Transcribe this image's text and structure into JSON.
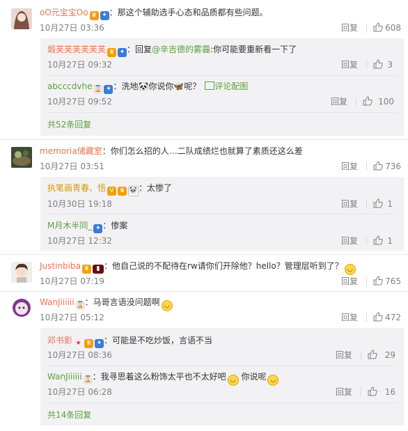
{
  "comments": [
    {
      "user": "oO元宝宝Oo",
      "text": "：那这个辅助选手心态和品质都有些问题。",
      "time": "10月27日 03:36",
      "reply": "回复",
      "likes": "608",
      "replies": [
        {
          "user": "煅芙芙芙芙芙芙",
          "mention": "@辛吉德的雾霾",
          "pre": "：回复",
          "text": ":你可能要重新看一下了",
          "time": "10月27日 09:32",
          "reply": "回复",
          "likes": "3"
        },
        {
          "user": "abcccdvhe",
          "text": "：洗地🐼你说你🦋呢？",
          "pic_link": "评论配图",
          "time": "10月27日 09:52",
          "reply": "回复",
          "likes": "100"
        }
      ],
      "more": "共52条回复"
    },
    {
      "user": "memoria储藏室",
      "text": "：你们怎么招的人…二队成绩烂也就算了素质还这么差",
      "time": "10月27日 03:51",
      "reply": "回复",
      "likes": "736",
      "replies": [
        {
          "user": "执笔画青春、悟",
          "text": "：太惨了",
          "time": "10月30日 19:18",
          "reply": "回复",
          "likes": "1"
        },
        {
          "user": "M月木半同_",
          "text": "：惨案",
          "time": "10月27日 12:32",
          "reply": "回复",
          "likes": "1"
        }
      ]
    },
    {
      "user": "Justinbiba",
      "text": "：他自己说的不配待在rw请你们开除他？hello？管理层听到了？",
      "time": "10月27日 07:19",
      "reply": "回复",
      "likes": "765"
    },
    {
      "user": "WanJiiiiii",
      "text": "：马哥言语没问题啊",
      "time": "10月27日 05:12",
      "reply": "回复",
      "likes": "472",
      "replies": [
        {
          "user": "邓书影",
          "text": "：可能是不吃炒饭，言语不当",
          "time": "10月27日 08:36",
          "reply": "回复",
          "likes": "29"
        },
        {
          "user": "WanJiiiiii",
          "text": "：我寻思着这么粉饰太平也不太好吧",
          "text2": "你说呢",
          "time": "10月27日 06:28",
          "reply": "回复",
          "likes": "16"
        }
      ],
      "more": "共14条回复"
    }
  ],
  "colors": {
    "link_green": "#5b9f3a",
    "name_orange": "#eb7350",
    "gray": "#808080",
    "subbox_bg": "#f2f2f5"
  },
  "icons": {
    "like": "thumbs-up-icon"
  }
}
